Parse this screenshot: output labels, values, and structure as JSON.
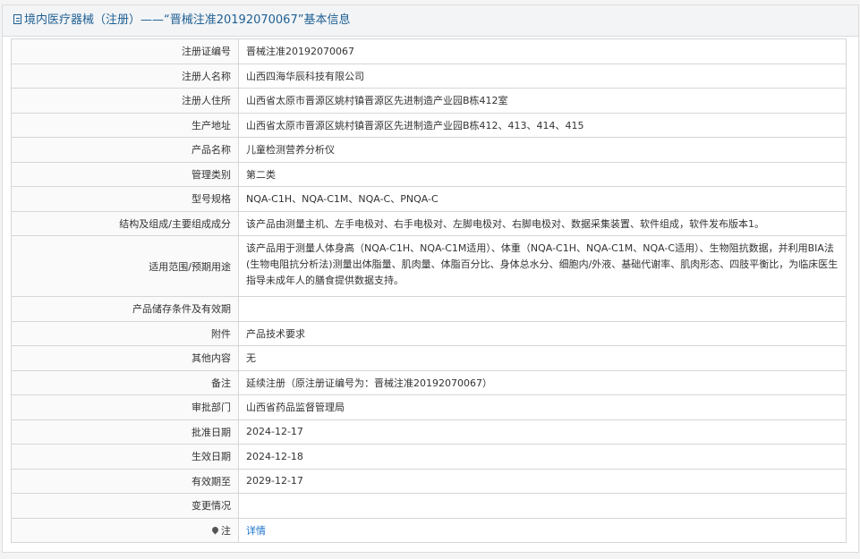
{
  "header": {
    "title": "境内医疗器械（注册）——“晋械注准20192070067”基本信息"
  },
  "rows": [
    {
      "label": "注册证编号",
      "value": "晋械注准20192070067"
    },
    {
      "label": "注册人名称",
      "value": "山西四海华辰科技有限公司"
    },
    {
      "label": "注册人住所",
      "value": "山西省太原市晋源区姚村镇晋源区先进制造产业园B栋412室"
    },
    {
      "label": "生产地址",
      "value": "山西省太原市晋源区姚村镇晋源区先进制造产业园B栋412、413、414、415"
    },
    {
      "label": "产品名称",
      "value": "儿童检测营养分析仪"
    },
    {
      "label": "管理类别",
      "value": "第二类"
    },
    {
      "label": "型号规格",
      "value": "NQA-C1H、NQA-C1M、NQA-C、PNQA-C"
    },
    {
      "label": "结构及组成/主要组成成分",
      "value": "该产品由测量主机、左手电极对、右手电极对、左脚电极对、右脚电极对、数据采集装置、软件组成，软件发布版本1。"
    },
    {
      "label": "适用范围/预期用途",
      "value": "该产品用于测量人体身高（NQA-C1H、NQA-C1M适用）、体重（NQA-C1H、NQA-C1M、NQA-C适用）、生物阻抗数据，并利用BIA法(生物电阻抗分析法)测量出体脂量、肌肉量、体脂百分比、身体总水分、细胞内/外液、基础代谢率、肌肉形态、四肢平衡比，为临床医生指导未成年人的膳食提供数据支持。"
    },
    {
      "label": "产品储存条件及有效期",
      "value": ""
    },
    {
      "label": "附件",
      "value": "产品技术要求"
    },
    {
      "label": "其他内容",
      "value": "无"
    },
    {
      "label": "备注",
      "value": "延续注册（原注册证编号为：晋械注准20192070067）"
    },
    {
      "label": "审批部门",
      "value": "山西省药品监督管理局"
    },
    {
      "label": "批准日期",
      "value": "2024-12-17"
    },
    {
      "label": "生效日期",
      "value": "2024-12-18"
    },
    {
      "label": "有效期至",
      "value": "2029-12-17"
    },
    {
      "label": "变更情况",
      "value": ""
    }
  ],
  "note": {
    "label": "注",
    "link_text": "详情",
    "icon": "pin-icon"
  }
}
